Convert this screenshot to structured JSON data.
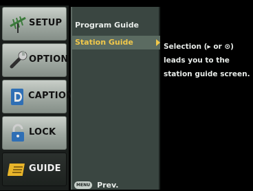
{
  "tabs": [
    {
      "label": "SETUP",
      "icon": "antenna-icon"
    },
    {
      "label": "OPTION",
      "icon": "wrench-icon"
    },
    {
      "label": "CAPTION",
      "icon": "caption-icon"
    },
    {
      "label": "LOCK",
      "icon": "padlock-icon"
    },
    {
      "label": "GUIDE",
      "icon": "guide-book-icon"
    }
  ],
  "active_tab": "GUIDE",
  "menu": {
    "items": [
      "Program Guide",
      "Station Guide"
    ],
    "selected": "Station Guide",
    "prev_key": "MENU",
    "prev_label": "Prev."
  },
  "help": {
    "line1": "Selection (▸ or ⊙)",
    "line2": "leads you to the",
    "line3": "station guide screen."
  },
  "colors": {
    "highlight_text": "#f1c84a",
    "menu_bg": "#3a4641",
    "tab_bg": "#9fa8a1"
  }
}
